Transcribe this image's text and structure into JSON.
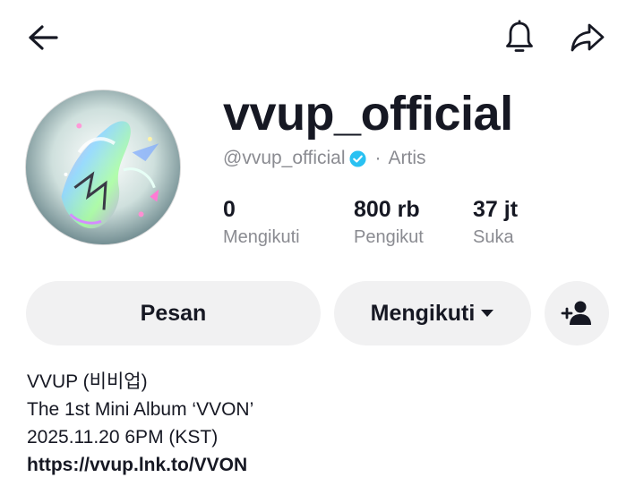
{
  "header": {
    "back_icon": "arrow-left-icon",
    "notification_icon": "bell-icon",
    "share_icon": "share-arrow-icon"
  },
  "profile": {
    "username": "vvup_official",
    "handle": "@vvup_official",
    "verified_icon": "verified-badge-icon",
    "separator": "·",
    "category": "Artis",
    "colors": {
      "text_primary": "#161823",
      "text_secondary": "#8a8b91",
      "verified_blue": "#20d5ec",
      "button_bg": "#f1f1f2"
    }
  },
  "stats": [
    {
      "value": "0",
      "label": "Mengikuti"
    },
    {
      "value": "800 rb",
      "label": "Pengikut"
    },
    {
      "value": "37 jt",
      "label": "Suka"
    }
  ],
  "actions": {
    "message_label": "Pesan",
    "following_label": "Mengikuti",
    "following_caret_icon": "caret-down-icon",
    "add_friend_icon": "add-user-icon"
  },
  "bio": {
    "lines": [
      "VVUP (비비업)",
      "The 1st Mini Album ‘VVON’",
      "2025.11.20 6PM (KST)"
    ],
    "link": "https://vvup.lnk.to/VVON"
  }
}
